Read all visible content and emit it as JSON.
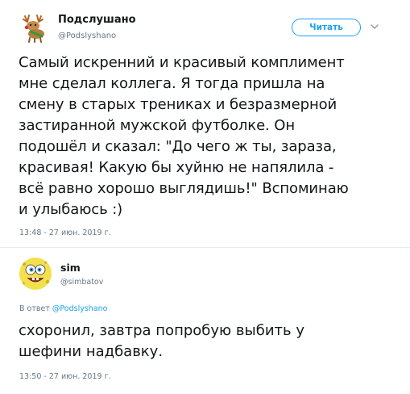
{
  "tweet": {
    "author_name": "Подслушано",
    "author_handle": "@Podslyshano",
    "follow_label": "Читать",
    "text": "Самый искренний и красивый комплимент\nмне сделал коллега. Я тогда пришла на\nсмену в старых трениках и безразмерной\nзастиранной мужской футболке. Он\nподошёл и сказал: \"До чего ж ты, зараза,\nкрасивая! Какую бы хуйню не напялила -\nвсё равно хорошо выглядишь!\" Вспоминаю\nи улыбаюсь :)",
    "timestamp": "13:48 - 27 июн. 2019 г.",
    "avatar_icon": "reindeer-logo-icon"
  },
  "reply": {
    "author_name": "sim",
    "author_handle": "@simbatov",
    "reply_to_prefix": "В ответ",
    "reply_to_handle": "@Podslyshano",
    "text": "схоронил, завтра попробую выбить у\nшефини надбавку.",
    "timestamp": "13:50 - 27 июн. 2019 г.",
    "avatar_icon": "sponge-cartoon-avatar-icon"
  },
  "colors": {
    "accent": "#1da1f2",
    "text": "#14171a",
    "muted": "#657786",
    "divider": "#e6ecf0"
  }
}
